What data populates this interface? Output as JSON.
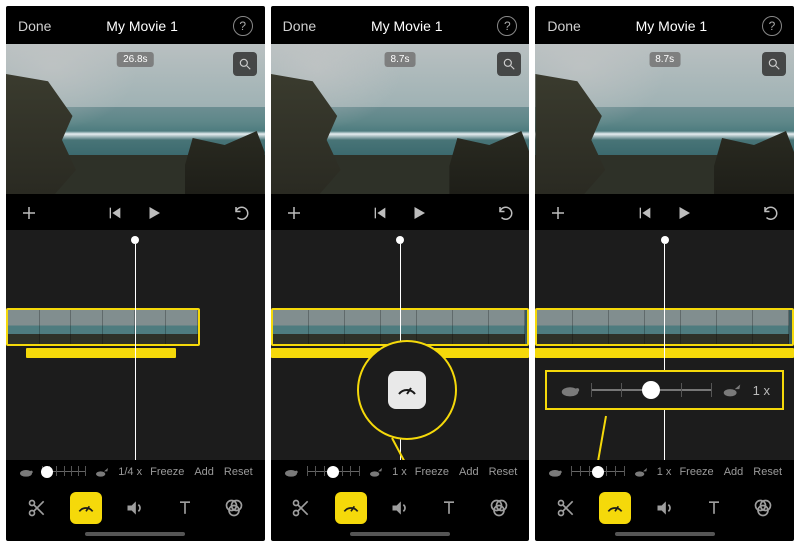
{
  "screens": [
    {
      "nav": {
        "done": "Done",
        "title": "My Movie 1",
        "help": "?"
      },
      "duration_badge": "26.8s",
      "speed": {
        "value_label": "1/4 x",
        "freeze": "Freeze",
        "add": "Add",
        "reset": "Reset",
        "knob_pct": 12
      },
      "active_tool": "speed"
    },
    {
      "nav": {
        "done": "Done",
        "title": "My Movie 1",
        "help": "?"
      },
      "duration_badge": "8.7s",
      "speed": {
        "value_label": "1 x",
        "freeze": "Freeze",
        "add": "Add",
        "reset": "Reset",
        "knob_pct": 50
      },
      "active_tool": "speed"
    },
    {
      "nav": {
        "done": "Done",
        "title": "My Movie 1",
        "help": "?"
      },
      "duration_badge": "8.7s",
      "speed": {
        "value_label": "1 x",
        "freeze": "Freeze",
        "add": "Add",
        "reset": "Reset",
        "knob_pct": 50
      },
      "callout": {
        "value_label": "1 x",
        "knob_pct": 50
      },
      "active_tool": "speed"
    }
  ]
}
